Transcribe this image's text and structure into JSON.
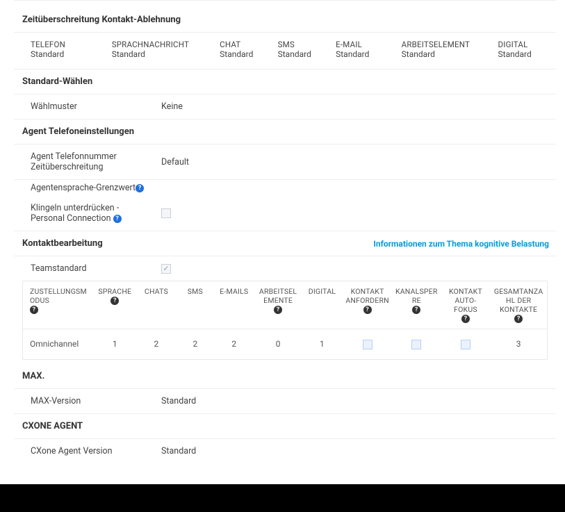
{
  "timeout": {
    "title": "Zeitüberschreitung Kontakt-Ablehnung",
    "cols": [
      {
        "head": "TELEFON",
        "val": "Standard"
      },
      {
        "head": "SPRACHNACHRICHT",
        "val": "Standard"
      },
      {
        "head": "CHAT",
        "val": "Standard"
      },
      {
        "head": "SMS",
        "val": "Standard"
      },
      {
        "head": "E-MAIL",
        "val": "Standard"
      },
      {
        "head": "ARBEITSELEMENT",
        "val": "Standard"
      },
      {
        "head": "DIGITAL",
        "val": "Standard"
      }
    ]
  },
  "dialing": {
    "title": "Standard-Wählen",
    "pattern_label": "Wählmuster",
    "pattern_value": "Keine"
  },
  "phone": {
    "title": "Agent Telefoneinstellungen",
    "phone_timeout_label": "Agent Telefonnummer Zeitüberschreitung",
    "phone_timeout_value": "Default",
    "voice_threshold_label": "Agentensprache-Grenzwert",
    "suppress_ring_label": "Klingeln unterdrücken - Personal Connection"
  },
  "contact": {
    "title": "Kontaktbearbeitung",
    "link": "Informationen zum Thema kognitive Belastung",
    "teamdefault_label": "Teamstandard",
    "headers": [
      "ZUSTELLUNGSMODUS",
      "SPRACHE",
      "CHATS",
      "SMS",
      "E-MAILS",
      "ARBEITSELEMENTE",
      "DIGITAL",
      "KONTAKT ANFORDERN",
      "KANALSPERRE",
      "KONTAKT AUTO-FOKUS",
      "GESAMTANZAHL DER KONTAKTE"
    ],
    "header_help": [
      true,
      true,
      false,
      false,
      false,
      true,
      false,
      true,
      true,
      true,
      true
    ],
    "row": {
      "mode": "Omnichannel",
      "sprache": "1",
      "chats": "2",
      "sms": "2",
      "emails": "2",
      "arbeits": "0",
      "digital": "1",
      "total": "3"
    }
  },
  "max": {
    "title": "MAX.",
    "version_label": "MAX-Version",
    "version_value": "Standard"
  },
  "cxone": {
    "title": "CXONE AGENT",
    "version_label": "CXone Agent Version",
    "version_value": "Standard"
  }
}
